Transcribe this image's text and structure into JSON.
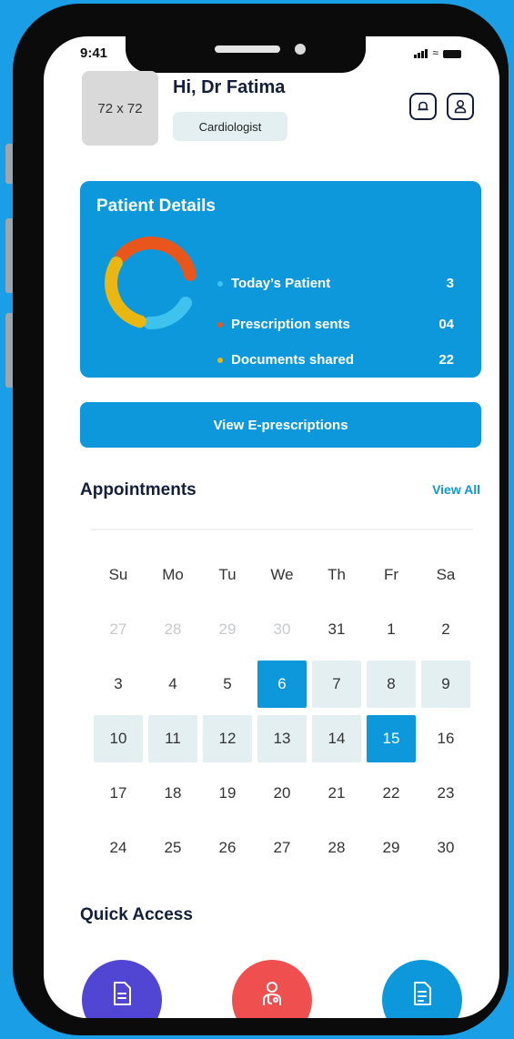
{
  "status_bar": {
    "time": "9:41"
  },
  "profile": {
    "avatar_placeholder": "72 x 72",
    "greeting": "Hi, Dr Fatima",
    "specialty": "Cardiologist",
    "icons": [
      "bell-icon",
      "user-icon"
    ]
  },
  "patient_details": {
    "title": "Patient Details",
    "items": [
      {
        "label": "Today’s Patient",
        "value": "3",
        "color": "#3ec3ee"
      },
      {
        "label": "Prescription sents",
        "value": "04",
        "color": "#e8561c"
      },
      {
        "label": "Documents shared",
        "value": "22",
        "color": "#e9b612"
      }
    ]
  },
  "cta": {
    "label": "View E-prescriptions"
  },
  "appointments": {
    "title": "Appointments",
    "view_all": "View All",
    "weekdays": [
      "Su",
      "Mo",
      "Tu",
      "We",
      "Th",
      "Fr",
      "Sa"
    ],
    "weeks": [
      [
        {
          "d": "27",
          "muted": true
        },
        {
          "d": "28",
          "muted": true
        },
        {
          "d": "29",
          "muted": true
        },
        {
          "d": "30",
          "muted": true
        },
        {
          "d": "31"
        },
        {
          "d": "1"
        },
        {
          "d": "2"
        }
      ],
      [
        {
          "d": "3"
        },
        {
          "d": "4"
        },
        {
          "d": "5"
        },
        {
          "d": "6",
          "selected": true
        },
        {
          "d": "7",
          "range": true
        },
        {
          "d": "8",
          "range": true
        },
        {
          "d": "9",
          "range": true
        }
      ],
      [
        {
          "d": "10",
          "range": true
        },
        {
          "d": "11",
          "range": true
        },
        {
          "d": "12",
          "range": true
        },
        {
          "d": "13",
          "range": true
        },
        {
          "d": "14",
          "range": true
        },
        {
          "d": "15",
          "selected": true
        },
        {
          "d": "16"
        }
      ],
      [
        {
          "d": "17"
        },
        {
          "d": "18"
        },
        {
          "d": "19"
        },
        {
          "d": "20"
        },
        {
          "d": "21"
        },
        {
          "d": "22"
        },
        {
          "d": "23"
        }
      ],
      [
        {
          "d": "24"
        },
        {
          "d": "25"
        },
        {
          "d": "26"
        },
        {
          "d": "27"
        },
        {
          "d": "28"
        },
        {
          "d": "29"
        },
        {
          "d": "30"
        }
      ]
    ]
  },
  "quick_access": {
    "title": "Quick Access",
    "buttons": [
      {
        "icon": "document-icon",
        "color": "#5146d4"
      },
      {
        "icon": "doctor-icon",
        "color": "#ef4f4f"
      },
      {
        "icon": "file-text-icon",
        "color": "#0d98dc"
      }
    ]
  }
}
